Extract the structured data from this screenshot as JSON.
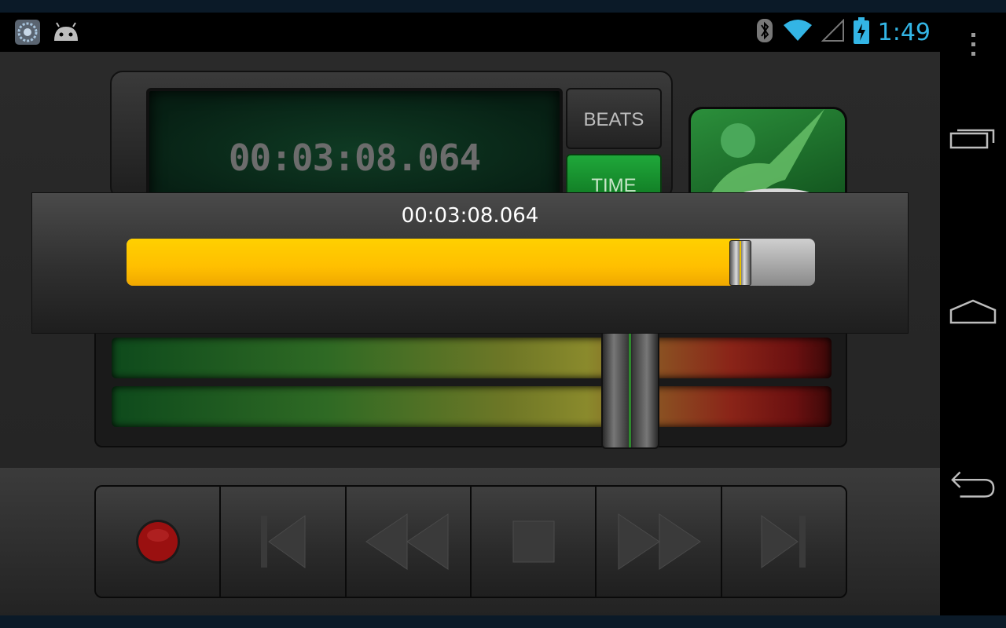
{
  "status_bar": {
    "clock": "1:49",
    "notification_icons": [
      "app-notification-icon",
      "android-icon"
    ],
    "system_icons": [
      "bluetooth-icon",
      "wifi-icon",
      "cell-signal-icon",
      "battery-charging-icon"
    ]
  },
  "nav_bar": {
    "overflow": "overflow-menu-icon",
    "recents": "recent-apps-icon",
    "home": "home-icon",
    "back": "back-icon"
  },
  "display": {
    "lcd_time": "00:03:08.064",
    "beats_label": "BEATS",
    "time_label": "TIME",
    "time_mode_color": "#1fa83a"
  },
  "seek_dialog": {
    "position_text": "00:03:08.064",
    "progress": 0.89,
    "fill_color": "#ffc400"
  },
  "level_meter": {
    "fader_level": 0.72
  },
  "transport": {
    "buttons": [
      "record-button",
      "skip-to-start-button",
      "rewind-button",
      "stop-button",
      "fast-forward-button",
      "skip-to-end-button"
    ],
    "record_color": "#9a1010"
  }
}
